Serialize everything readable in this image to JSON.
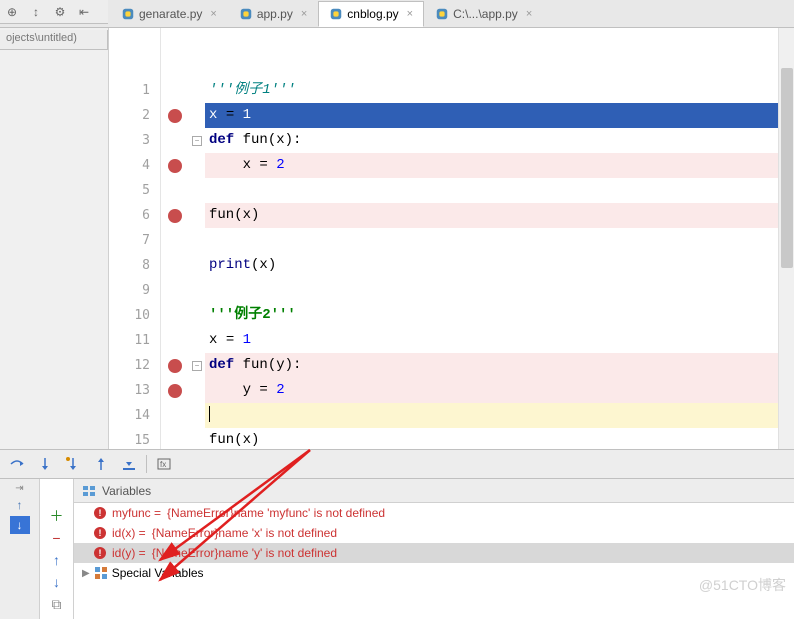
{
  "project_path": "ojects\\untitled)",
  "tabs": [
    {
      "label": "genarate.py",
      "active": false
    },
    {
      "label": "app.py",
      "active": false
    },
    {
      "label": "cnblog.py",
      "active": true
    },
    {
      "label": "C:\\...\\app.py",
      "active": false
    }
  ],
  "code": {
    "lines": [
      {
        "n": 1,
        "bp": false,
        "fold": "",
        "hl": "",
        "tokens": [
          [
            "str",
            "'''例子1'''"
          ]
        ]
      },
      {
        "n": 2,
        "bp": true,
        "fold": "",
        "hl": "exec",
        "tokens": [
          [
            "",
            "x "
          ],
          [
            "op",
            "= "
          ],
          [
            "num",
            "1"
          ]
        ]
      },
      {
        "n": 3,
        "bp": false,
        "fold": "-",
        "hl": "",
        "tokens": [
          [
            "kw",
            "def "
          ],
          [
            "fn",
            "fun"
          ],
          [
            "op",
            "("
          ],
          [
            "",
            "x"
          ],
          [
            "op",
            ")"
          ],
          [
            "op",
            ":"
          ]
        ]
      },
      {
        "n": 4,
        "bp": true,
        "fold": "",
        "hl": "bp",
        "tokens": [
          [
            "",
            "    x "
          ],
          [
            "op",
            "= "
          ],
          [
            "num",
            "2"
          ]
        ]
      },
      {
        "n": 5,
        "bp": false,
        "fold": "",
        "hl": "",
        "tokens": [
          [
            "",
            ""
          ]
        ]
      },
      {
        "n": 6,
        "bp": true,
        "fold": "",
        "hl": "bp",
        "tokens": [
          [
            "",
            "fun"
          ],
          [
            "op",
            "("
          ],
          [
            "",
            "x"
          ],
          [
            "op",
            ")"
          ]
        ]
      },
      {
        "n": 7,
        "bp": false,
        "fold": "",
        "hl": "",
        "tokens": [
          [
            "",
            ""
          ]
        ]
      },
      {
        "n": 8,
        "bp": false,
        "fold": "",
        "hl": "",
        "tokens": [
          [
            "builtin",
            "print"
          ],
          [
            "op",
            "("
          ],
          [
            "",
            "x"
          ],
          [
            "op",
            ")"
          ]
        ]
      },
      {
        "n": 9,
        "bp": false,
        "fold": "",
        "hl": "",
        "tokens": [
          [
            "",
            ""
          ]
        ]
      },
      {
        "n": 10,
        "bp": false,
        "fold": "",
        "hl": "",
        "tokens": [
          [
            "str2",
            "'''例子2'''"
          ]
        ]
      },
      {
        "n": 11,
        "bp": false,
        "fold": "",
        "hl": "",
        "tokens": [
          [
            "",
            "x "
          ],
          [
            "op",
            "= "
          ],
          [
            "num",
            "1"
          ]
        ]
      },
      {
        "n": 12,
        "bp": true,
        "fold": "-",
        "hl": "bp",
        "tokens": [
          [
            "kw",
            "def "
          ],
          [
            "fn",
            "fun"
          ],
          [
            "op",
            "("
          ],
          [
            "",
            "y"
          ],
          [
            "op",
            ")"
          ],
          [
            "op",
            ":"
          ]
        ]
      },
      {
        "n": 13,
        "bp": true,
        "fold": "",
        "hl": "bp",
        "tokens": [
          [
            "",
            "    y "
          ],
          [
            "op",
            "= "
          ],
          [
            "num",
            "2"
          ]
        ]
      },
      {
        "n": 14,
        "bp": false,
        "fold": "",
        "hl": "cur",
        "tokens": [
          [
            "cursor",
            ""
          ]
        ]
      },
      {
        "n": 15,
        "bp": false,
        "fold": "",
        "hl": "",
        "tokens": [
          [
            "",
            "fun"
          ],
          [
            "op",
            "("
          ],
          [
            "",
            "x"
          ],
          [
            "op",
            ")"
          ]
        ]
      }
    ]
  },
  "variables_panel": {
    "title": "Variables",
    "rows": [
      {
        "name": "myfunc",
        "sep": "=",
        "err": "{NameError}name 'myfunc' is not defined",
        "sel": false
      },
      {
        "name": "id(x)",
        "sep": "=",
        "err": "{NameError}name 'x' is not defined",
        "sel": false
      },
      {
        "name": "id(y)",
        "sep": "=",
        "err": "{NameError}name 'y' is not defined",
        "sel": true
      }
    ],
    "special": "Special Variables"
  },
  "watermark": "@51CTO博客"
}
